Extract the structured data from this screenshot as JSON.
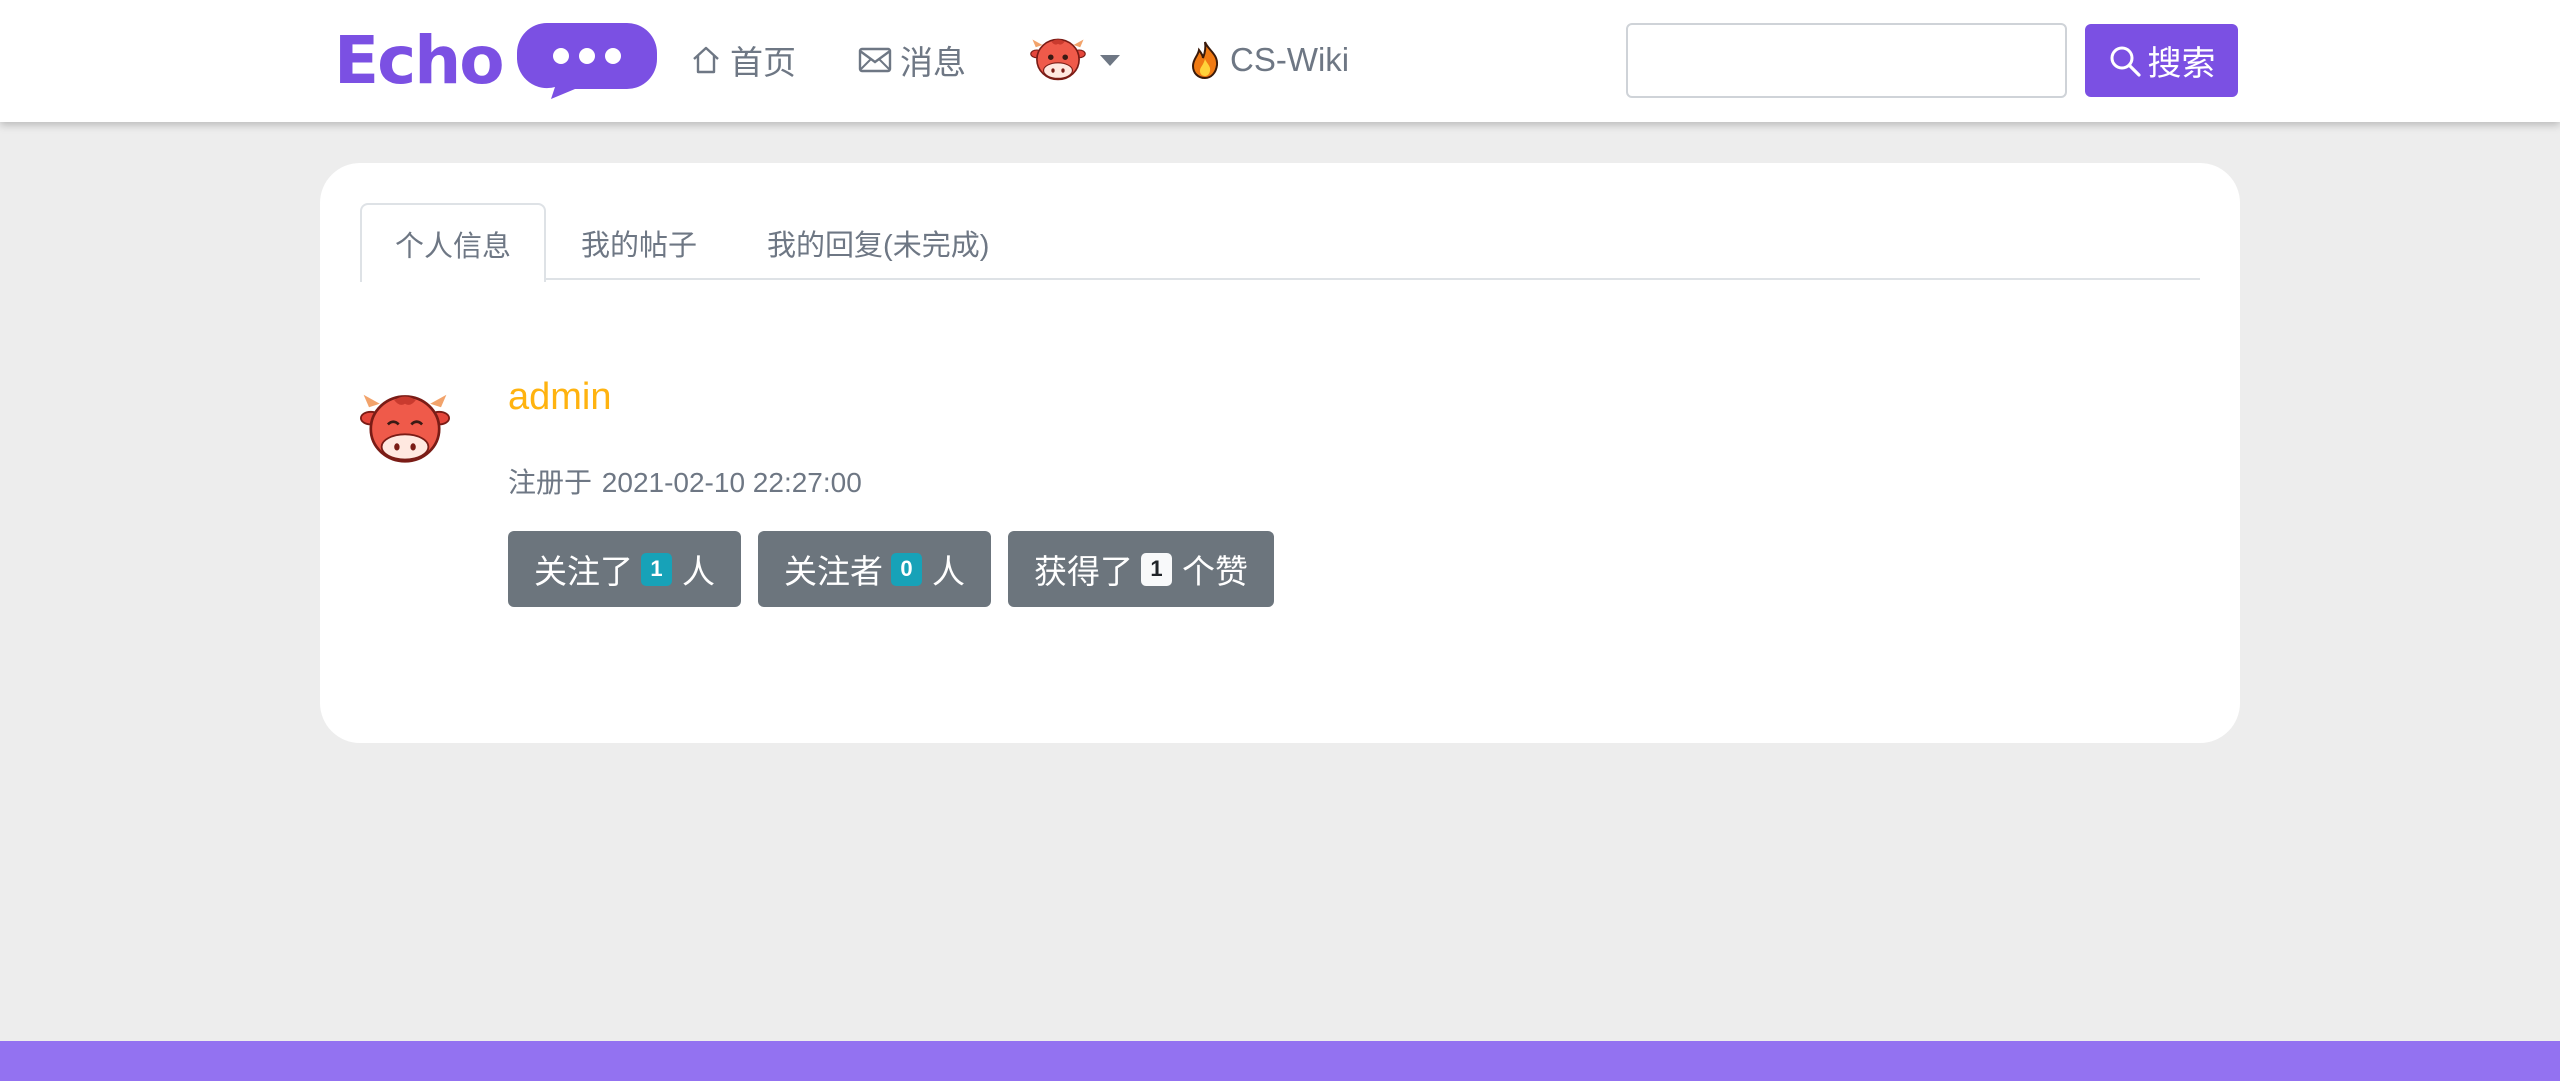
{
  "brand": {
    "name": "Echo",
    "color": "#7b50e3"
  },
  "nav": {
    "home": {
      "label": "首页",
      "icon": "home-icon"
    },
    "messages": {
      "label": "消息",
      "icon": "envelope-icon"
    },
    "user_menu": {
      "icon": "cow-avatar-icon"
    },
    "wiki": {
      "label": "CS-Wiki",
      "icon": "fire-icon"
    }
  },
  "search": {
    "value": "",
    "button_label": "搜索",
    "icon": "search-icon"
  },
  "tabs": [
    {
      "label": "个人信息",
      "active": true
    },
    {
      "label": "我的帖子",
      "active": false
    },
    {
      "label": "我的回复(未完成)",
      "active": false
    }
  ],
  "profile": {
    "username": "admin",
    "register_prefix": "注册于",
    "register_time": "2021-02-10 22:27:00",
    "stats": {
      "following": {
        "prefix": "关注了",
        "count": "1",
        "suffix": "人"
      },
      "followers": {
        "prefix": "关注者",
        "count": "0",
        "suffix": "人"
      },
      "likes": {
        "prefix": "获得了",
        "count": "1",
        "suffix": "个赞"
      }
    }
  },
  "colors": {
    "accent": "#7b50e3",
    "username": "#ffb30f",
    "footer": "#9372f1",
    "stat_button": "#6c757d",
    "badge_info": "#17a2b8"
  }
}
